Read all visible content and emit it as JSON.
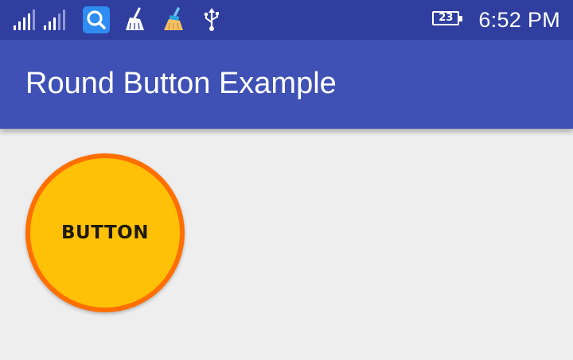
{
  "status_bar": {
    "icons": [
      "signal-1-icon",
      "signal-2-icon",
      "search-app-icon",
      "cleaner-app-icon",
      "broom-app-icon",
      "usb-icon"
    ],
    "battery_level": "23",
    "time": "6:52 PM"
  },
  "app_bar": {
    "title": "Round Button Example"
  },
  "content": {
    "button_label": "BUTTON"
  },
  "colors": {
    "status_bar": "#303f9f",
    "app_bar": "#3f51b5",
    "background": "#eeeeee",
    "button_fill": "#ffc107",
    "button_border": "#ff6f00"
  }
}
